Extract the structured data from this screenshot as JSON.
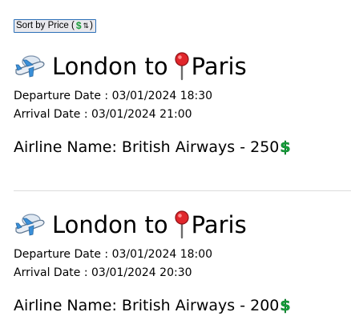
{
  "sort_button": {
    "label": "Sort by Price (",
    "dollar_glyph": "$",
    "arrows_glyph": "⇅",
    "suffix": ")"
  },
  "flights": [
    {
      "origin": "London",
      "connector": "to",
      "destination": "Paris",
      "departure_label": "Departure Date : ",
      "departure": "03/01/2024 18:30",
      "arrival_label": "Arrival Date : ",
      "arrival": "03/01/2024 21:00",
      "airline_label": "Airline Name: ",
      "airline": "British Airways",
      "separator": " - ",
      "price": "250",
      "currency_glyph": "$"
    },
    {
      "origin": "London",
      "connector": "to",
      "destination": "Paris",
      "departure_label": "Departure Date : ",
      "departure": "03/01/2024 18:00",
      "arrival_label": "Arrival Date : ",
      "arrival": "03/01/2024 20:30",
      "airline_label": "Airline Name: ",
      "airline": "British Airways",
      "separator": " - ",
      "price": "200",
      "currency_glyph": "$"
    }
  ],
  "icons": {
    "plane": "airplane-icon",
    "pin": "round-pushpin-icon",
    "money": "heavy-dollar-sign-icon"
  },
  "colors": {
    "button_border": "#2c6fb7",
    "button_background": "#e9e9ed",
    "dollar_green": "#14a03a",
    "pin_red": "#e0262b",
    "divider": "#dcdcdc"
  }
}
